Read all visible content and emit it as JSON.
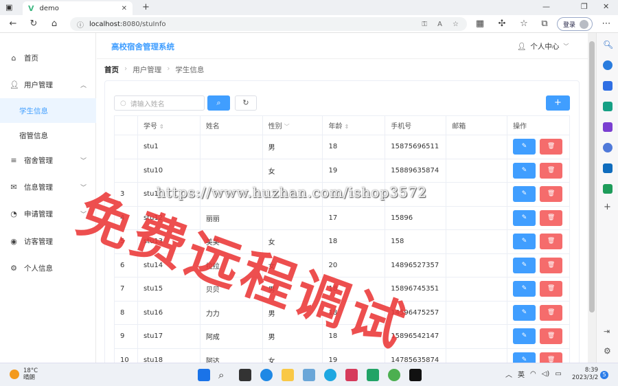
{
  "browser": {
    "tab_title": "demo",
    "url_host": "localhost",
    "url_path": ":8080/stuInfo",
    "login_label": "登录"
  },
  "header": {
    "system_title": "高校宿舍管理系统",
    "user_center": "个人中心"
  },
  "sidebar": {
    "items": [
      {
        "label": "首页",
        "icon": "home-icon"
      },
      {
        "label": "用户管理",
        "icon": "user-icon"
      },
      {
        "label": "学生信息",
        "icon": ""
      },
      {
        "label": "宿管信息",
        "icon": ""
      },
      {
        "label": "宿舍管理",
        "icon": "database-icon"
      },
      {
        "label": "信息管理",
        "icon": "mail-icon"
      },
      {
        "label": "申请管理",
        "icon": "pie-icon"
      },
      {
        "label": "访客管理",
        "icon": "eye-icon"
      },
      {
        "label": "个人信息",
        "icon": "gear-icon"
      }
    ]
  },
  "breadcrumb": [
    "首页",
    "用户管理",
    "学生信息"
  ],
  "search": {
    "placeholder": "请输入姓名"
  },
  "table": {
    "columns": [
      "学号",
      "姓名",
      "性别",
      "年龄",
      "手机号",
      "邮箱",
      "操作"
    ],
    "rows": [
      {
        "index": "",
        "id": "stu1",
        "name": "",
        "gender": "男",
        "age": "18",
        "phone": "15875696511",
        "email": ""
      },
      {
        "index": "",
        "id": "stu10",
        "name": "",
        "gender": "女",
        "age": "19",
        "phone": "15889635874",
        "email": ""
      },
      {
        "index": "3",
        "id": "stu1",
        "name": "",
        "gender": "",
        "age": "",
        "phone": "",
        "email": ""
      },
      {
        "index": "4",
        "id": "stu12",
        "name": "丽丽",
        "gender": "",
        "age": "17",
        "phone": "15896",
        "email": ""
      },
      {
        "index": "5",
        "id": "stu13",
        "name": "美美",
        "gender": "女",
        "age": "18",
        "phone": "158",
        "email": ""
      },
      {
        "index": "6",
        "id": "stu14",
        "name": "拉拉",
        "gender": "女",
        "age": "20",
        "phone": "14896527357",
        "email": ""
      },
      {
        "index": "7",
        "id": "stu15",
        "name": "贝贝",
        "gender": "男",
        "age": "18",
        "phone": "15896745351",
        "email": ""
      },
      {
        "index": "8",
        "id": "stu16",
        "name": "力力",
        "gender": "男",
        "age": "18",
        "phone": "14596475257",
        "email": ""
      },
      {
        "index": "9",
        "id": "stu17",
        "name": "阿成",
        "gender": "男",
        "age": "18",
        "phone": "15896542147",
        "email": ""
      },
      {
        "index": "10",
        "id": "stu18",
        "name": "阿达",
        "gender": "女",
        "age": "19",
        "phone": "14785635874",
        "email": ""
      }
    ]
  },
  "watermark": {
    "big_text": "免费远程调试",
    "url_text": "https://www.huzhan.com/ishop3572"
  },
  "taskbar": {
    "temperature": "18°C",
    "weather": "晴朗",
    "ime": "英",
    "time": "8:39",
    "date": "2023/3/2",
    "notifications": "5"
  }
}
